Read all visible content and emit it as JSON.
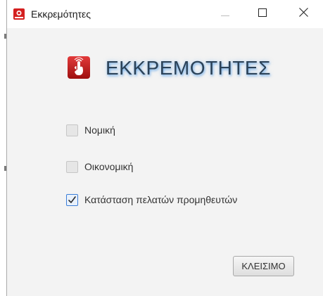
{
  "window": {
    "title": "Εκκρεμότητες"
  },
  "header": {
    "heading": "ΕΚΚΡΕΜΟΤΗΤΕΣ"
  },
  "checkboxes": [
    {
      "label": "Νομική",
      "checked": false
    },
    {
      "label": "Οικονομική",
      "checked": false
    },
    {
      "label": "Κατάσταση πελατών προμηθευτών",
      "checked": true
    }
  ],
  "footer": {
    "close_label": "ΚΛΕΙΣΙΜΟ"
  },
  "icons": {
    "app": "app-icon",
    "logo": "hand-pointer-icon",
    "minimize": "minimize-icon",
    "maximize": "maximize-icon",
    "close": "close-icon",
    "check": "checkmark-icon"
  },
  "colors": {
    "heading": "#2b4258",
    "accent": "#3b7dd8",
    "logo_red": "#c81e1e"
  }
}
